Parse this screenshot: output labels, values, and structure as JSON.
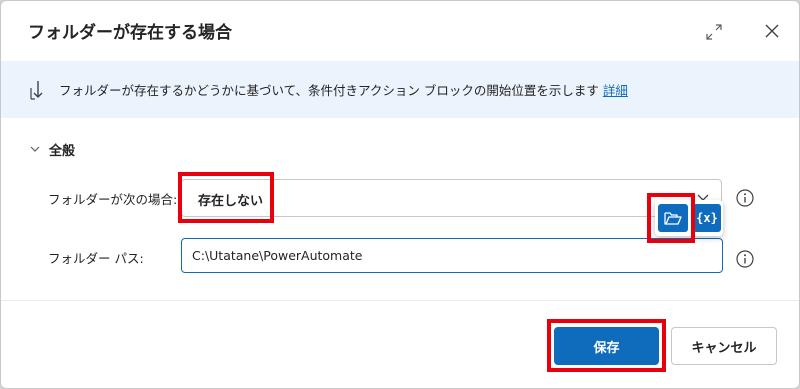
{
  "dialog": {
    "title": "フォルダーが存在する場合",
    "expand_icon": "expand-icon",
    "close_icon": "close-icon"
  },
  "info": {
    "icon": "branch-arrow-icon",
    "text": "フォルダーが存在するかどうかに基づいて、条件付きアクション ブロックの開始位置を示します",
    "link": "詳細"
  },
  "section": {
    "label": "全般",
    "expanded": true
  },
  "fields": {
    "condition_label": "フォルダーが次の場合:",
    "condition_value": "存在しない",
    "path_label": "フォルダー パス:",
    "path_value": "C:\\Utatane\\PowerAutomate",
    "variable_button": "{x}"
  },
  "buttons": {
    "save": "保存",
    "cancel": "キャンセル"
  },
  "colors": {
    "accent": "#0f6cbd",
    "info_background": "#ebf3fc",
    "highlight": "#e8000d"
  }
}
